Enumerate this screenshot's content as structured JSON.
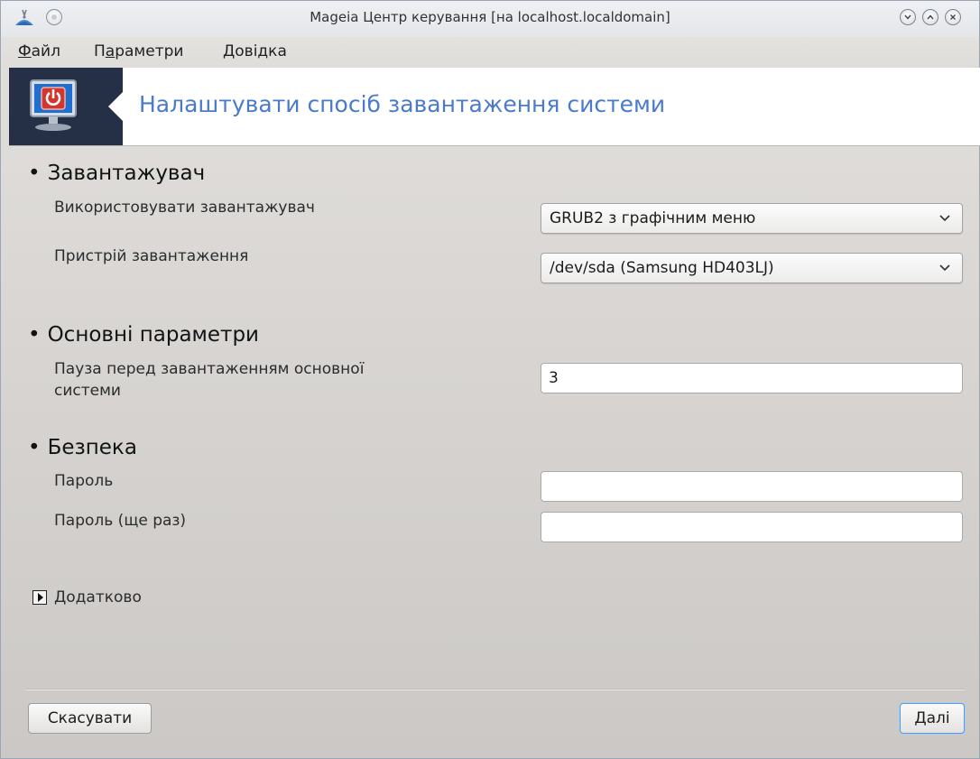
{
  "window": {
    "title": "Mageia Центр керування  [на localhost.localdomain]"
  },
  "menu": {
    "file": {
      "mnemonic": "Ф",
      "rest": "айл"
    },
    "settings": {
      "pre": "П",
      "mnemonic": "а",
      "rest": "раметри"
    },
    "help": {
      "mnemonic": "Д",
      "rest": "овідка"
    }
  },
  "banner": {
    "title": "Налаштувати спосіб завантаження системи",
    "accent_color": "#4a7ac9",
    "icon": "power-monitor-icon"
  },
  "sections": {
    "bootloader": {
      "heading": "Завантажувач",
      "use_label": "Використовувати завантажувач",
      "use_value": "GRUB2 з графічним меню",
      "device_label": "Пристрій завантаження",
      "device_value": "/dev/sda (Samsung HD403LJ)"
    },
    "main_options": {
      "heading": "Основні параметри",
      "delay_label_line1": "Пауза перед завантаженням основної",
      "delay_label_line2": "системи",
      "delay_value": "3"
    },
    "security": {
      "heading": "Безпека",
      "password_label": "Пароль",
      "password_value": "",
      "password_again_label": "Пароль (ще раз)",
      "password_again_value": ""
    }
  },
  "advanced": {
    "label": "Додатково",
    "expanded": false
  },
  "buttons": {
    "cancel": "Скасувати",
    "next": "Далі"
  }
}
